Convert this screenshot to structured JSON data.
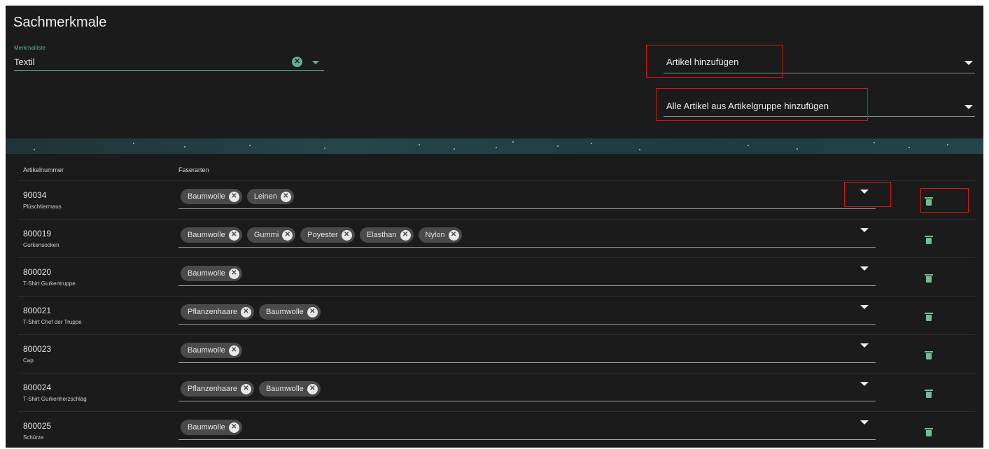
{
  "header": {
    "title": "Sachmerkmale"
  },
  "merkmalliste": {
    "label": "Merkmalliste",
    "value": "Textil"
  },
  "artikel_select": {
    "placeholder": "Artikel hinzufügen"
  },
  "gruppe_select": {
    "placeholder": "Alle Artikel aus Artikelgruppe hinzufügen"
  },
  "table": {
    "headers": {
      "artikelnummer": "Artikelnummer",
      "faserarten": "Faserarten"
    },
    "rows": [
      {
        "nummer": "90034",
        "name": "Plüschtiermaus",
        "fasern": [
          "Baumwolle",
          "Leinen"
        ]
      },
      {
        "nummer": "800019",
        "name": "Gurkensocken",
        "fasern": [
          "Baumwolle",
          "Gummi",
          "Poyester",
          "Elasthan",
          "Nylon"
        ]
      },
      {
        "nummer": "800020",
        "name": "T-Shirt Gurkentruppe",
        "fasern": [
          "Baumwolle"
        ]
      },
      {
        "nummer": "800021",
        "name": "T-Shirt Chef der Truppe",
        "fasern": [
          "Pflanzenhaare",
          "Baumwolle"
        ]
      },
      {
        "nummer": "800023",
        "name": "Cap",
        "fasern": [
          "Baumwolle"
        ]
      },
      {
        "nummer": "800024",
        "name": "T-Shirt Gurkenherzschlag",
        "fasern": [
          "Pflanzenhaare",
          "Baumwolle"
        ]
      },
      {
        "nummer": "800025",
        "name": "Schürze",
        "fasern": [
          "Baumwolle"
        ]
      }
    ]
  },
  "icons": {
    "clear": "clear-circle-icon",
    "dropdown": "caret-down-icon",
    "delete": "trash-icon",
    "chip_remove": "chip-remove-icon"
  },
  "colors": {
    "background": "#1b1b1b",
    "accent": "#5fb08f",
    "highlight_box": "#d01818",
    "chip": "#4a4a4a"
  }
}
